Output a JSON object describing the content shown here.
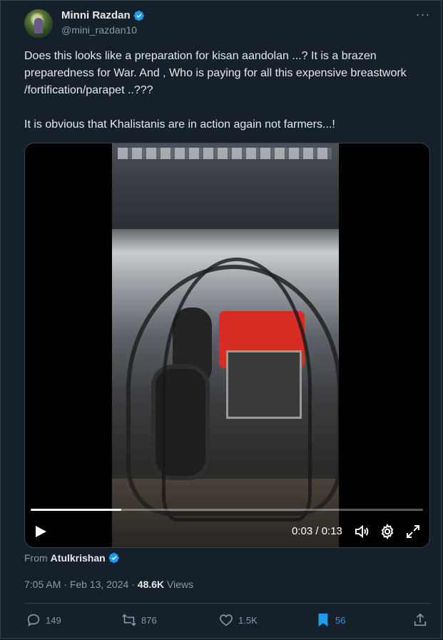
{
  "author": {
    "name": "Minni Razdan",
    "handle": "@mini_razdan10"
  },
  "tweet": {
    "paragraph1": "Does this looks like a preparation for kisan aandolan ...?  It is a brazen preparedness for War.  And , Who is paying for all this expensive breastwork /fortification/parapet  ..???",
    "paragraph2": "It is obvious that Khalistanis are in action again not farmers...!"
  },
  "video": {
    "current_time": "0:03",
    "duration": "0:13",
    "time_display": "0:03 / 0:13",
    "progress_fraction": 0.23
  },
  "source": {
    "from_label": "From",
    "user": "Atulkrishan"
  },
  "meta": {
    "time": "7:05 AM",
    "date": "Feb 13, 2024",
    "separator": "·",
    "views_count": "48.6K",
    "views_label": "Views"
  },
  "actions": {
    "replies": "149",
    "reposts": "876",
    "likes": "1.5K",
    "bookmarks": "56"
  },
  "colors": {
    "background": "#15202b",
    "accent": "#1d9bf0",
    "muted": "#8b98a5",
    "border": "#38444d"
  }
}
